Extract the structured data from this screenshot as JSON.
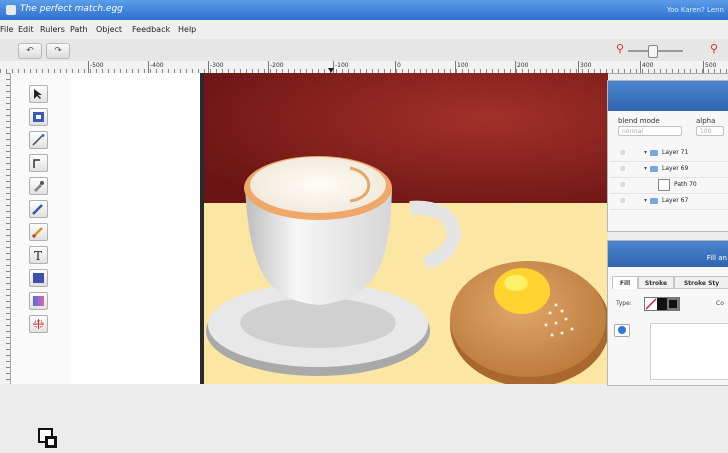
{
  "window": {
    "title": "The perfect match.egg",
    "title_right": "Yoo Karen? Lenn"
  },
  "menu": [
    "File",
    "Edit",
    "Rulers",
    "Path",
    "Object",
    "Feedback",
    "Help"
  ],
  "toolbar": {
    "undo_label": "↶",
    "redo_label": "↷"
  },
  "ruler": {
    "labels": [
      "-500",
      "-400",
      "-300",
      "-200",
      "-100",
      "0",
      "100",
      "200",
      "300",
      "400",
      "500"
    ]
  },
  "layers_panel": {
    "blend_mode_label": "blend mode",
    "alpha_label": "alpha",
    "blend_value": "normal",
    "alpha_value": "100",
    "layers": [
      {
        "name": "Layer 71",
        "kind": "folder"
      },
      {
        "name": "Layer 69",
        "kind": "folder"
      },
      {
        "name": "Path 70",
        "kind": "path"
      },
      {
        "name": "Layer 67",
        "kind": "folder"
      }
    ],
    "eye_glyph": "◎"
  },
  "fill_panel": {
    "header": "Fill an",
    "tabs": [
      "Fill",
      "Stroke",
      "Stroke Sty"
    ],
    "type_label": "Type:",
    "color_label": "Co"
  },
  "colors": {
    "accent": "#2f6fd0",
    "canvas_bg": "#8a1e1c",
    "tabletop": "#fbe6a3"
  }
}
